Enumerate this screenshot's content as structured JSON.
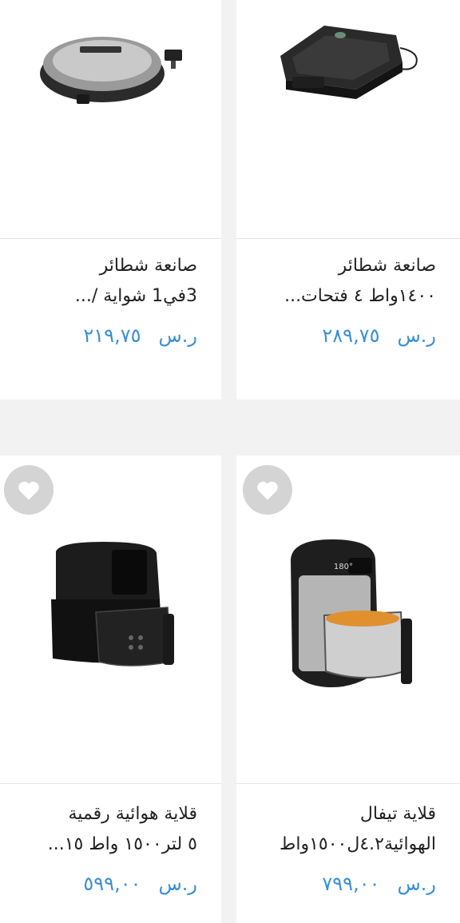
{
  "products": [
    {
      "name_line1": "صانعة شطائر",
      "name_line2": "١٤٠٠واط ٤ فتحات...",
      "currency": "ر.س",
      "price": "٢٨٩,٧٥",
      "image": "black-sandwich-maker"
    },
    {
      "name_line1": "صانعة شطائر",
      "name_line2": "3في1 شواية /...",
      "currency": "ر.س",
      "price": "٢١٩,٧٥",
      "image": "silver-sandwich-maker"
    },
    {
      "name_line1": "قلاية تيفال",
      "name_line2": "الهوائية٤.٢ل١٥٠٠واط",
      "currency": "ر.س",
      "price": "٧٩٩,٠٠",
      "image": "tefal-air-fryer"
    },
    {
      "name_line1": "قلاية هوائية رقمية",
      "name_line2": "٥ لتر١٥٠٠ واط ١٥...",
      "currency": "ر.س",
      "price": "٥٩٩,٠٠",
      "image": "black-digital-air-fryer"
    }
  ],
  "colors": {
    "price": "#3a8fd6",
    "heart_bg": "#d4d4d4",
    "background": "#f2f2f2"
  }
}
